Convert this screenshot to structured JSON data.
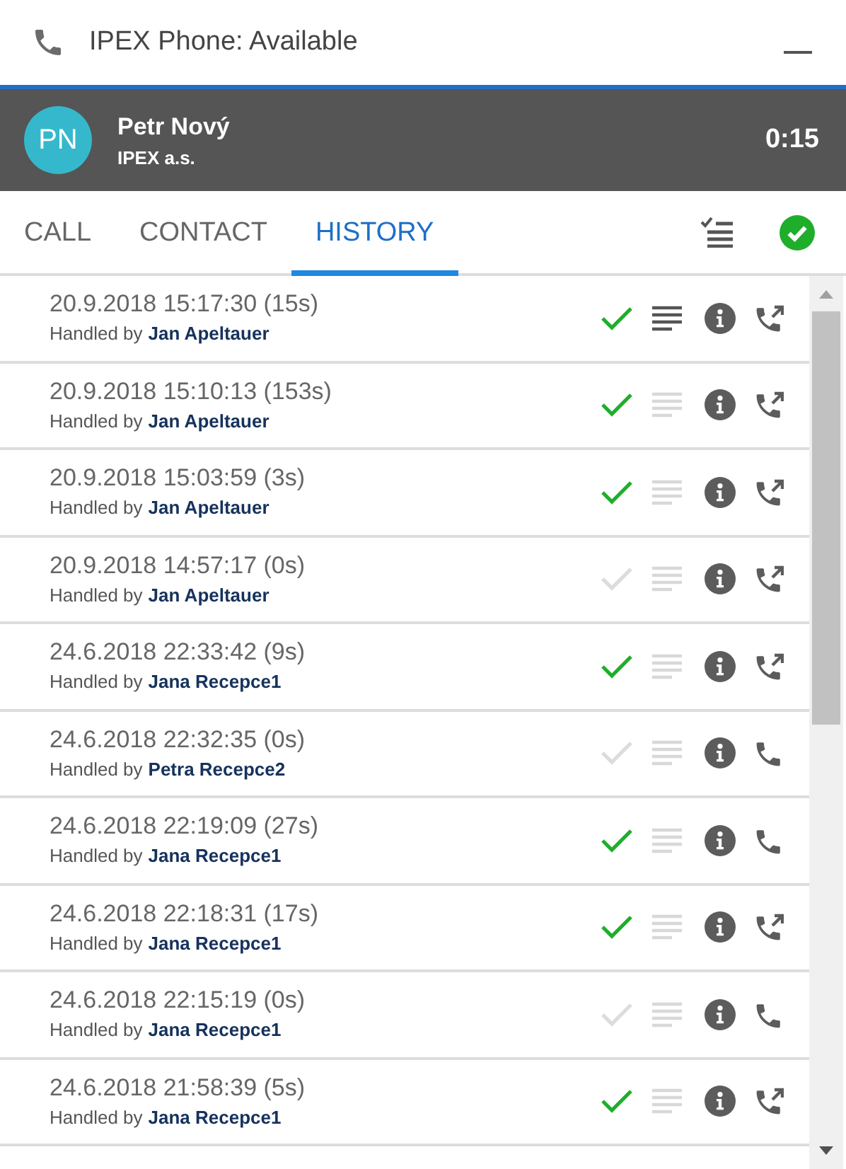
{
  "header": {
    "title": "IPEX Phone: Available"
  },
  "caller": {
    "initials": "PN",
    "name": "Petr Nový",
    "company": "IPEX a.s.",
    "duration": "0:15"
  },
  "tabs": [
    {
      "label": "CALL",
      "selected": false
    },
    {
      "label": "CONTACT",
      "selected": false
    },
    {
      "label": "HISTORY",
      "selected": true
    }
  ],
  "history": [
    {
      "time": "20.9.2018 15:17:30 (15s)",
      "handled_prefix": "Handled by",
      "agent": "Jan Apeltauer",
      "handled": true,
      "has_note": true,
      "outgoing": true
    },
    {
      "time": "20.9.2018 15:10:13 (153s)",
      "handled_prefix": "Handled by",
      "agent": "Jan Apeltauer",
      "handled": true,
      "has_note": false,
      "outgoing": true
    },
    {
      "time": "20.9.2018 15:03:59 (3s)",
      "handled_prefix": "Handled by",
      "agent": "Jan Apeltauer",
      "handled": true,
      "has_note": false,
      "outgoing": true
    },
    {
      "time": "20.9.2018 14:57:17 (0s)",
      "handled_prefix": "Handled by",
      "agent": "Jan Apeltauer",
      "handled": false,
      "has_note": false,
      "outgoing": true
    },
    {
      "time": "24.6.2018 22:33:42 (9s)",
      "handled_prefix": "Handled by",
      "agent": "Jana Recepce1",
      "handled": true,
      "has_note": false,
      "outgoing": true
    },
    {
      "time": "24.6.2018 22:32:35 (0s)",
      "handled_prefix": "Handled by",
      "agent": "Petra Recepce2",
      "handled": false,
      "has_note": false,
      "outgoing": false
    },
    {
      "time": "24.6.2018 22:19:09 (27s)",
      "handled_prefix": "Handled by",
      "agent": "Jana Recepce1",
      "handled": true,
      "has_note": false,
      "outgoing": false
    },
    {
      "time": "24.6.2018 22:18:31 (17s)",
      "handled_prefix": "Handled by",
      "agent": "Jana Recepce1",
      "handled": true,
      "has_note": false,
      "outgoing": true
    },
    {
      "time": "24.6.2018 22:15:19 (0s)",
      "handled_prefix": "Handled by",
      "agent": "Jana Recepce1",
      "handled": false,
      "has_note": false,
      "outgoing": false
    },
    {
      "time": "24.6.2018 21:58:39 (5s)",
      "handled_prefix": "Handled by",
      "agent": "Jana Recepce1",
      "handled": true,
      "has_note": false,
      "outgoing": true
    }
  ]
}
